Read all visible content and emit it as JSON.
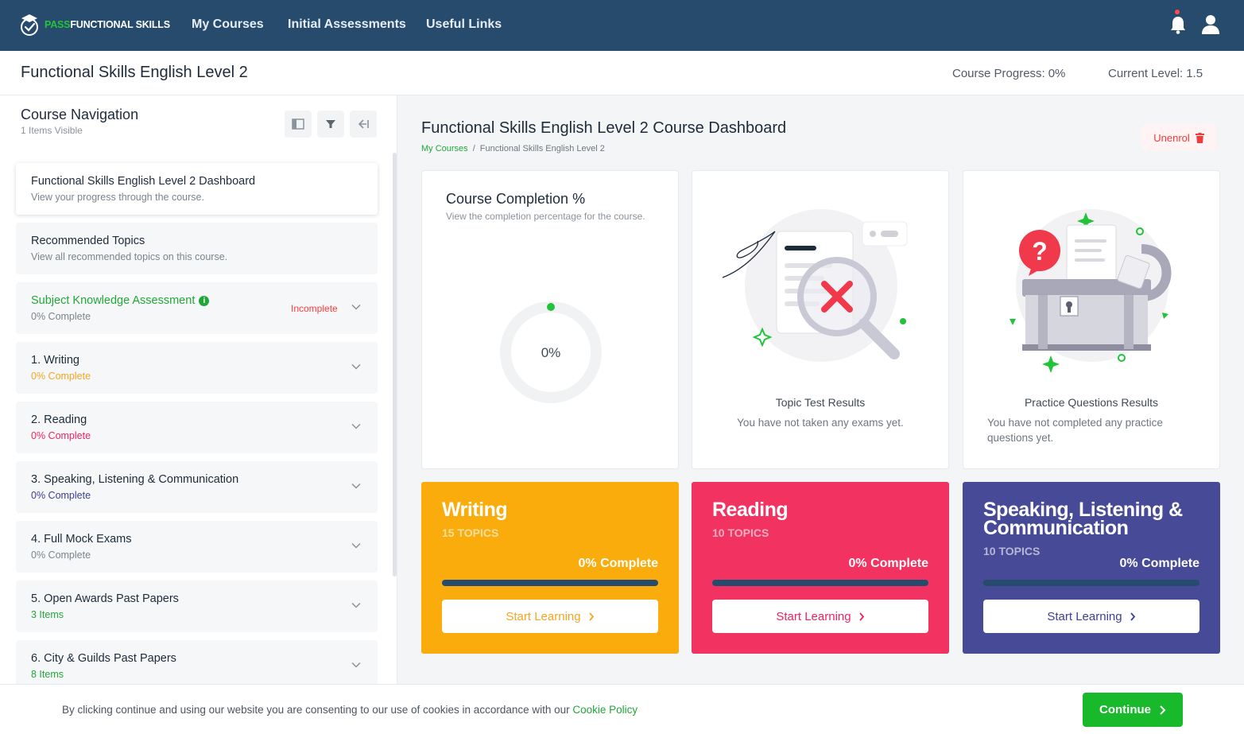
{
  "nav": {
    "brand_part1": "PASS",
    "brand_part2": "FUNCTIONAL SKILLS",
    "links": [
      "My Courses",
      "Initial Assessments",
      "Useful Links"
    ]
  },
  "header": {
    "course_title": "Functional Skills English Level 2",
    "progress_label": "Course Progress:",
    "progress_value": "0%",
    "level_label": "Current Level:",
    "level_value": "1.5"
  },
  "sidebar": {
    "title": "Course Navigation",
    "subtitle": "1 Items Visible",
    "items": [
      {
        "title": "Functional Skills English Level 2 Dashboard",
        "sub": "View your progress through the course.",
        "sub_color": "#7b848d"
      },
      {
        "title": "Recommended Topics",
        "sub": "View all recommended topics on this course.",
        "sub_color": "#7b848d"
      },
      {
        "title": "Subject Knowledge Assessment",
        "sub": "0% Complete",
        "sub_color": "#7b848d",
        "status": "Incomplete"
      },
      {
        "title": "1. Writing",
        "sub": "0% Complete",
        "sub_color": "#f5a623"
      },
      {
        "title": "2. Reading",
        "sub": "0% Complete",
        "sub_color": "#f0245d"
      },
      {
        "title": "3. Speaking, Listening & Communication",
        "sub": "0% Complete",
        "sub_color": "#3d3f8f"
      },
      {
        "title": "4. Full Mock Exams",
        "sub": "0% Complete",
        "sub_color": "#7b848d"
      },
      {
        "title": "5. Open Awards Past Papers",
        "sub": "3 Items",
        "sub_color": "#22a63a"
      },
      {
        "title": "6. City & Guilds Past Papers",
        "sub": "8 Items",
        "sub_color": "#22a63a"
      }
    ]
  },
  "main": {
    "title": "Functional Skills English Level 2 Course Dashboard",
    "breadcrumb": [
      "My Courses",
      "Functional Skills English Level 2"
    ],
    "unenrol_label": "Unenrol",
    "completion": {
      "title": "Course Completion %",
      "subtitle": "View the completion percentage for the course.",
      "value_text": "0%",
      "value": 0
    },
    "topic_tests": {
      "caption": "Topic Test Results",
      "message": "You have not taken any exams yet."
    },
    "practice": {
      "caption": "Practice Questions Results",
      "message": "You have not completed any practice questions yet."
    },
    "subjects": [
      {
        "name": "Writing",
        "topics": "15 TOPICS",
        "progress_text": "0% Complete",
        "progress": 0,
        "cta": "Start Learning",
        "color": "#f9ac0b",
        "cta_color": "#f5a623"
      },
      {
        "name": "Reading",
        "topics": "10 TOPICS",
        "progress_text": "0% Complete",
        "progress": 0,
        "cta": "Start Learning",
        "color": "#f23260",
        "cta_color": "#f0245d"
      },
      {
        "name": "Speaking, Listening & Communication",
        "topics": "10 TOPICS",
        "progress_text": "0% Complete",
        "progress": 0,
        "cta": "Start Learning",
        "color": "#464a97",
        "cta_color": "#3d3f8f"
      }
    ]
  },
  "cookie": {
    "text": "By clicking continue and using our website you are consenting to our use of cookies in accordance with our ",
    "link": "Cookie Policy",
    "button": "Continue"
  }
}
